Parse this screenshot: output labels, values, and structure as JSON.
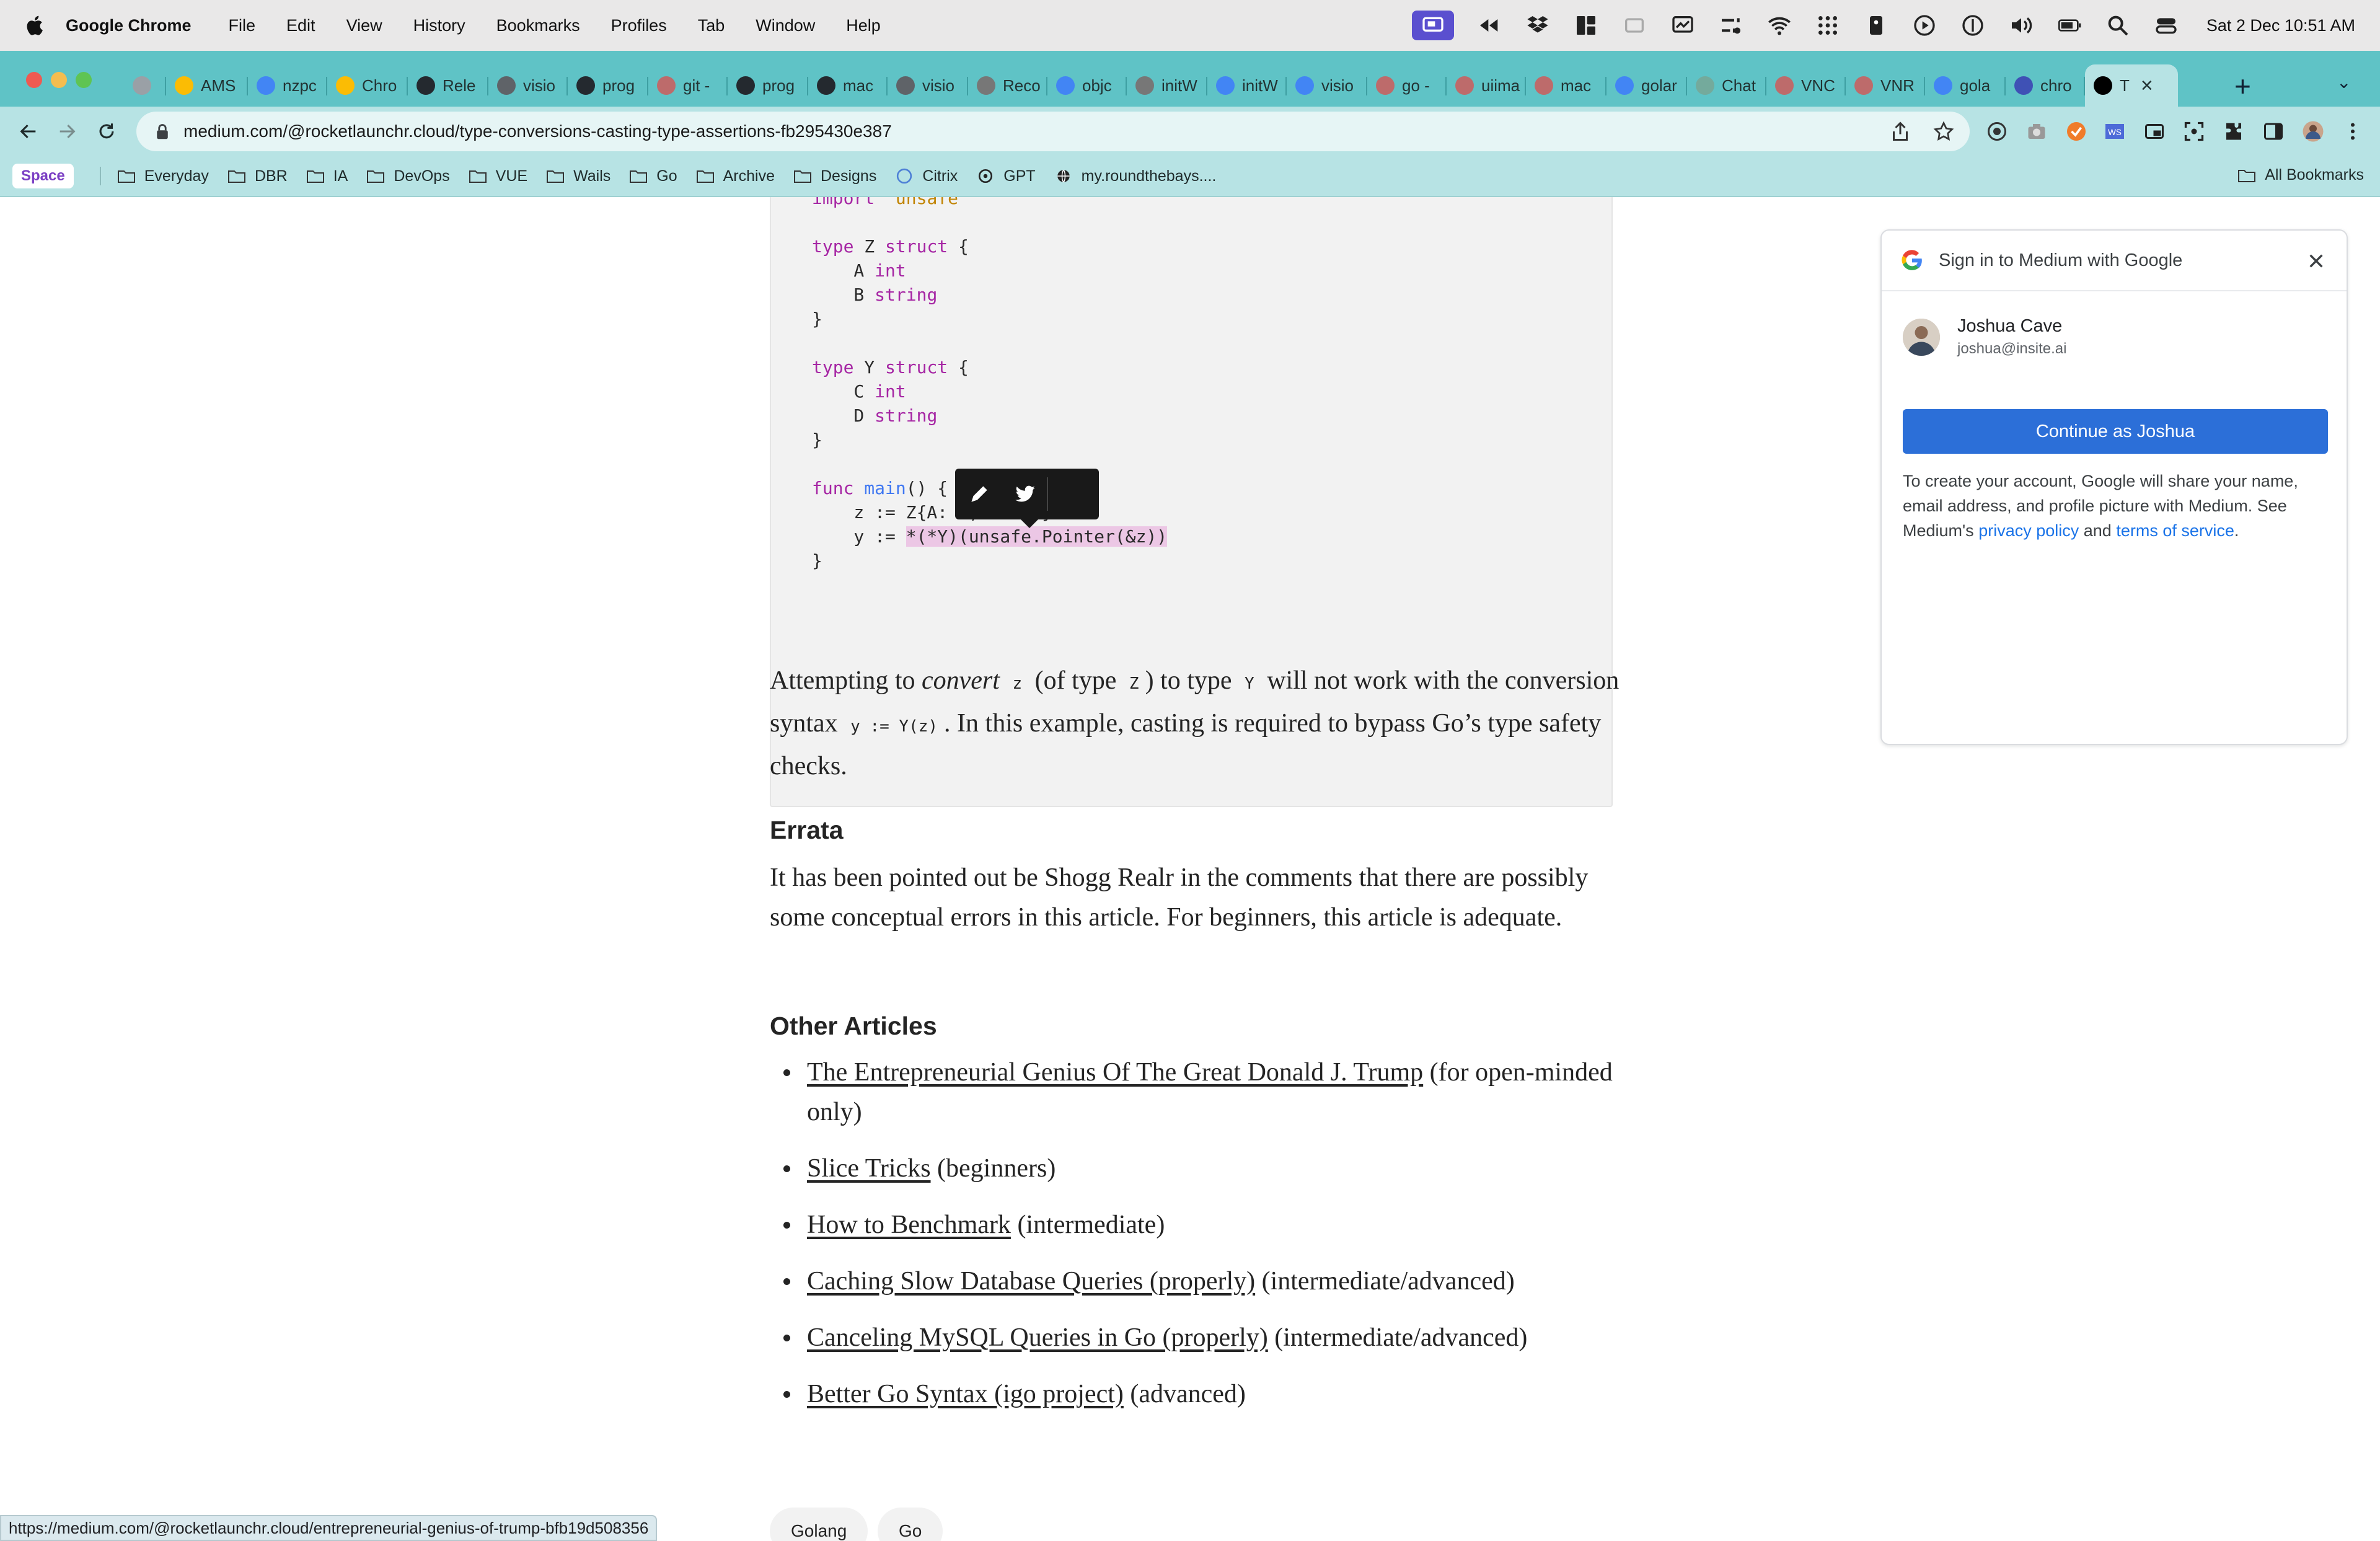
{
  "menubar": {
    "app_name": "Google Chrome",
    "items": [
      "File",
      "Edit",
      "View",
      "History",
      "Bookmarks",
      "Profiles",
      "Tab",
      "Window",
      "Help"
    ],
    "clock": "Sat 2 Dec  10:51 AM"
  },
  "tabs": [
    {
      "label": "",
      "icon": "globe-icon",
      "color": "#9aa0a6"
    },
    {
      "label": "AMS",
      "icon": "chrome-icon",
      "color": "#fbbc04"
    },
    {
      "label": "nzpc",
      "icon": "google-icon",
      "color": "#4285f4"
    },
    {
      "label": "Chro",
      "icon": "chrome-icon",
      "color": "#fbbc04"
    },
    {
      "label": "Rele",
      "icon": "github-icon",
      "color": "#24292f"
    },
    {
      "label": "visio",
      "icon": "page-icon",
      "color": "#5f6368"
    },
    {
      "label": "prog",
      "icon": "github-icon",
      "color": "#24292f"
    },
    {
      "label": "git -",
      "icon": "apple-icon",
      "color": "#bd6b6b"
    },
    {
      "label": "prog",
      "icon": "github-icon",
      "color": "#24292f"
    },
    {
      "label": "mac",
      "icon": "github-icon",
      "color": "#24292f"
    },
    {
      "label": "visio",
      "icon": "page-icon",
      "color": "#5f6368"
    },
    {
      "label": "Reco",
      "icon": "apple-icon",
      "color": "#777"
    },
    {
      "label": "objc",
      "icon": "google-icon",
      "color": "#4285f4"
    },
    {
      "label": "initW",
      "icon": "apple-icon",
      "color": "#777"
    },
    {
      "label": "initW",
      "icon": "google-icon",
      "color": "#4285f4"
    },
    {
      "label": "visio",
      "icon": "google-icon",
      "color": "#4285f4"
    },
    {
      "label": "go -",
      "icon": "apple-icon",
      "color": "#bd6b6b"
    },
    {
      "label": "uiima",
      "icon": "apple-icon",
      "color": "#bd6b6b"
    },
    {
      "label": "mac",
      "icon": "apple-icon",
      "color": "#bd6b6b"
    },
    {
      "label": "golar",
      "icon": "google-icon",
      "color": "#4285f4"
    },
    {
      "label": "Chat",
      "icon": "openai-icon",
      "color": "#74aa9c"
    },
    {
      "label": "VNC",
      "icon": "apple-icon",
      "color": "#bd6b6b"
    },
    {
      "label": "VNR",
      "icon": "apple-icon",
      "color": "#bd6b6b"
    },
    {
      "label": "gola",
      "icon": "google-icon",
      "color": "#4285f4"
    },
    {
      "label": "chro",
      "icon": "star-icon",
      "color": "#3f51b5"
    },
    {
      "label": "T",
      "icon": "medium-icon",
      "color": "#000000"
    }
  ],
  "toolbar": {
    "url": "medium.com/@rocketlaunchr.cloud/type-conversions-casting-type-assertions-fb295430e387"
  },
  "bookmarks": {
    "space_label": "Space",
    "items": [
      "Everyday",
      "DBR",
      "IA",
      "DevOps",
      "VUE",
      "Wails",
      "Go",
      "Archive",
      "Designs",
      "Citrix",
      "GPT",
      "my.roundthebays...."
    ],
    "all_label": "All Bookmarks"
  },
  "code": {
    "lines": [
      "import \"unsafe\"",
      "",
      "type Z struct {",
      "    A int",
      "    B string",
      "}",
      "",
      "type Y struct {",
      "    C int",
      "    D string",
      "}",
      "",
      "func main() {",
      "    z := Z{A: 1, B: \"\"}",
      "    y := *(*Y)(unsafe.Pointer(&z))",
      "}"
    ]
  },
  "article": {
    "para1": {
      "t1": "Attempting to ",
      "em": "convert",
      "c1": "z",
      "t2": " (of type ",
      "c2": "Z",
      "t3": ") to type ",
      "c3": "Y",
      "t4": " will not work with the conversion syntax ",
      "c4": "y := Y(z)",
      "t5": ". In this example, casting is required to bypass Go’s type safety checks."
    },
    "errata_heading": "Errata",
    "errata_text": "It has been pointed out be Shogg Realr in the comments that there are possibly some conceptual errors in this article. For beginners, this article is adequate.",
    "other_heading": "Other Articles",
    "other_articles": [
      {
        "link": "The Entrepreneurial Genius Of The Great Donald J. Trump",
        "note": " (for open-minded only)"
      },
      {
        "link": "Slice Tricks",
        "note": " (beginners)"
      },
      {
        "link": "How to Benchmark",
        "note": " (intermediate)"
      },
      {
        "link": "Caching Slow Database Queries (properly)",
        "note": " (intermediate/advanced)"
      },
      {
        "link": "Canceling MySQL Queries in Go (properly)",
        "note": " (intermediate/advanced)"
      },
      {
        "link": "Better Go Syntax (igo project)",
        "note": " (advanced)"
      }
    ],
    "tags": [
      "Golang",
      "Go"
    ]
  },
  "google_signin": {
    "title": "Sign in to Medium with Google",
    "name": "Joshua Cave",
    "email": "joshua@insite.ai",
    "button": "Continue as Joshua",
    "text_before": "To create your account, Google will share your name, email address, and profile picture with Medium. See Medium's ",
    "privacy": "privacy policy",
    "and": " and ",
    "terms": "terms of service",
    "period": "."
  },
  "status_bar": {
    "url": "https://medium.com/@rocketlaunchr.cloud/entrepreneurial-genius-of-trump-bfb19d508356"
  },
  "colors": {
    "tab_strip": "#5fc3c6",
    "toolbar": "#b7e3e4",
    "google_button": "#2c6fd8",
    "code_keyword": "#a626a4",
    "selection": "#ecc7e5"
  }
}
